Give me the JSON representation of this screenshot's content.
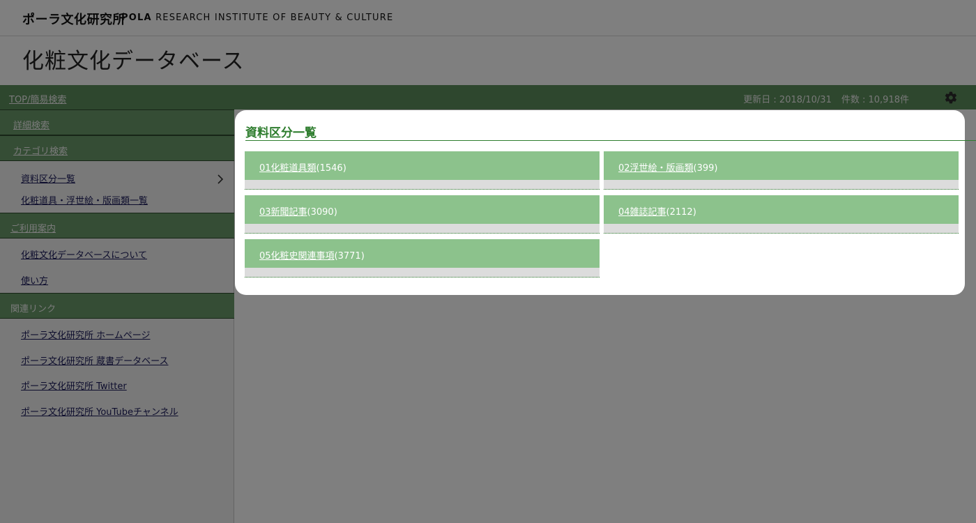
{
  "header": {
    "logo_jp": "ポーラ文化研究所",
    "logo_en_bold": "POLA",
    "logo_en_rest": " RESEARCH INSTITUTE OF BEAUTY & CULTURE",
    "site_title": "化粧文化データベース"
  },
  "topbar": {
    "top_link": "TOP/簡易検索",
    "updated": "更新日 : 2018/10/31",
    "count": "件数 : 10,918件",
    "settings_icon": "gear-icon"
  },
  "sidebar": {
    "detail_search": "詳細検索",
    "category_search": "カテゴリ検索",
    "category_links": [
      "資料区分一覧",
      "化粧道具・浮世絵・版画類一覧"
    ],
    "guide_head": "ご利用案内",
    "guide_links": [
      "化粧文化データベースについて",
      "使い方"
    ],
    "related_head": "関連リンク",
    "related_links": [
      "ポーラ文化研究所 ホームページ",
      "ポーラ文化研究所 蔵書データベース",
      "ポーラ文化研究所 Twitter",
      "ポーラ文化研究所 YouTubeチャンネル"
    ]
  },
  "modal": {
    "title": "資料区分一覧",
    "items": [
      {
        "label": "01化粧道具類",
        "count": "(1546)"
      },
      {
        "label": "02浮世絵・版画類",
        "count": "(399)"
      },
      {
        "label": "03新聞記事",
        "count": "(3090)"
      },
      {
        "label": "04雑誌記事",
        "count": "(2112)"
      },
      {
        "label": "05化粧史関連事項",
        "count": "(3771)"
      }
    ]
  },
  "colors": {
    "bar_green": "#5d8e5d",
    "tile_green": "#8cc28c",
    "title_green": "#2e7d2e"
  }
}
